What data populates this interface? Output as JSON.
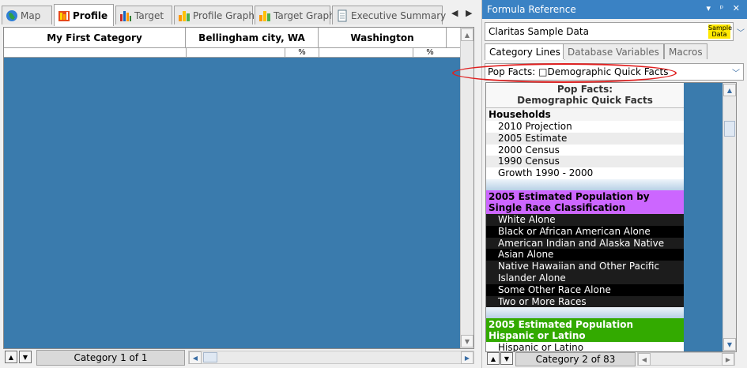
{
  "left_pane": {
    "tabs": [
      {
        "label": "Map",
        "icon": "globe-icon"
      },
      {
        "label": "Profile",
        "icon": "profile-icon",
        "active": true
      },
      {
        "label": "Target",
        "icon": "target-icon"
      },
      {
        "label": "Profile Graph",
        "icon": "bar-chart-icon"
      },
      {
        "label": "Target Graph",
        "icon": "bar-chart-icon"
      },
      {
        "label": "Executive Summary",
        "icon": "document-icon"
      }
    ],
    "grid": {
      "columns": [
        "My First Category",
        "Bellingham city, WA",
        "Washington"
      ],
      "pct_label": "%"
    },
    "footer": {
      "category_label": "Category 1 of 1"
    },
    "colors": {
      "grid_background": "#3a7bad"
    }
  },
  "formula_reference": {
    "title": "Formula Reference",
    "title_controls": "▾ ᵖ ✕",
    "data_source": "Claritas Sample Data",
    "sample_badge": "Sample Data",
    "tabs": [
      "Category Lines",
      "Database Variables",
      "Macros"
    ],
    "active_tab": "Category Lines",
    "category_selector": "Pop Facts: □Demographic Quick Facts",
    "list_header_line1": "Pop Facts:",
    "list_header_line2": "Demographic Quick Facts",
    "groups": [
      {
        "title": "Households",
        "style": "plain",
        "items": [
          "2010 Projection",
          "2005 Estimate",
          "2000 Census",
          "1990 Census",
          "Growth 1990 - 2000"
        ]
      },
      {
        "title": "2005 Estimated Population by Single Race Classification",
        "style": "purple",
        "items": [
          "White Alone",
          "Black or African American Alone",
          "American Indian and Alaska Native",
          "Asian Alone",
          "Native Hawaiian and Other Pacific Islander Alone",
          "Some Other Race Alone",
          "Two or More Races"
        ]
      },
      {
        "title": "2005 Estimated Population Hispanic or Latino",
        "style": "green",
        "items": [
          "Hispanic or Latino"
        ]
      }
    ],
    "footer": {
      "category_label": "Category 2 of 83"
    },
    "colors": {
      "title_bar": "#3a82c4",
      "purple_group": "#cc66ff",
      "green_group": "#33aa00",
      "highlight_oval": "#e02020"
    }
  }
}
